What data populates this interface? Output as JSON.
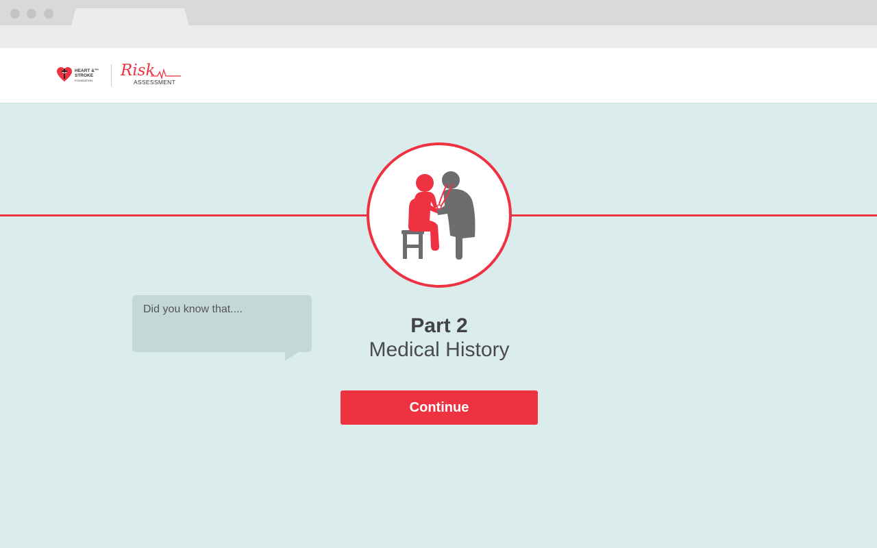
{
  "brand": {
    "foundation_line1": "HEART &™",
    "foundation_line2": "STROKE",
    "foundation_line3": "FOUNDATION",
    "app_name": "Risk",
    "app_subtitle": "ASSESSMENT"
  },
  "colors": {
    "accent": "#ee3242",
    "background": "#dbeced",
    "bubble": "#c5d8d8"
  },
  "section": {
    "icon": "doctor-patient-icon",
    "title": "Part 2",
    "subtitle": "Medical History"
  },
  "tip": {
    "text": "Did you know that...."
  },
  "actions": {
    "continue_label": "Continue"
  }
}
